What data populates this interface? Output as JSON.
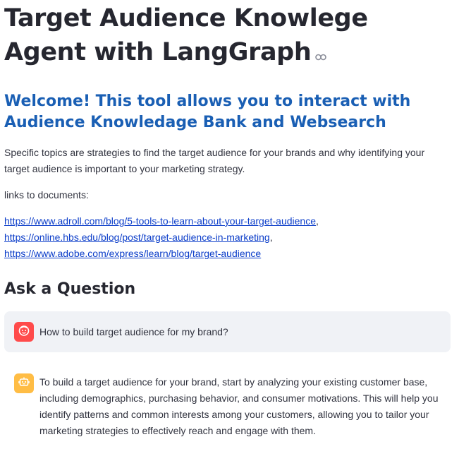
{
  "header": {
    "title": "Target Audience Knowlege Agent with LangGraph",
    "anchor_icon": "link-icon"
  },
  "welcome": {
    "heading": "Welcome! This tool allows you to interact with Audience Knowledage Bank and Websearch",
    "description": "Specific topics are strategies to find the target audience for your brands and why identifying your target audience is important to your marketing strategy.",
    "links_label": "links to documents:"
  },
  "links": [
    {
      "text": "https://www.adroll.com/blog/5-tools-to-learn-about-your-target-audience",
      "suffix": ","
    },
    {
      "text": "https://online.hbs.edu/blog/post/target-audience-in-marketing",
      "suffix": ","
    },
    {
      "text": "https://www.adobe.com/express/learn/blog/target-audience",
      "suffix": ""
    }
  ],
  "chat": {
    "heading": "Ask a Question",
    "user_message": "How to build target audience for my brand?",
    "assistant_message": "To build a target audience for your brand, start by analyzing your existing customer base, including demographics, purchasing behavior, and consumer motivations. This will help you identify patterns and common interests among your customers, allowing you to tailor your marketing strategies to effectively reach and engage with them.",
    "user_avatar_icon": "user-face-icon",
    "assistant_avatar_icon": "robot-icon"
  },
  "colors": {
    "welcome_heading": "#1a5fb4",
    "link": "#0a3cc9",
    "user_avatar": "#ff4b4b",
    "assistant_avatar": "#ffbd45",
    "user_bubble": "#f0f2f6"
  }
}
